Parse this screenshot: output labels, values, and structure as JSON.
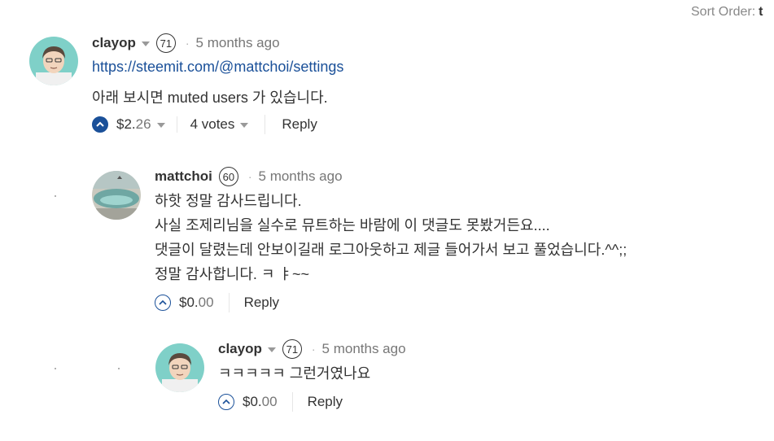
{
  "sort": {
    "label": "Sort Order:",
    "value": "t"
  },
  "comments": [
    {
      "author": "clayop",
      "reputation": "71",
      "time": "5 months ago",
      "link": "https://steemit.com/@mattchoi/settings",
      "lines": [
        "아래 보시면 muted users 가 있습니다."
      ],
      "payout_main": "$2.",
      "payout_cents": "26",
      "votes": "4 votes",
      "reply": "Reply",
      "upvoted": true
    },
    {
      "author": "mattchoi",
      "reputation": "60",
      "time": "5 months ago",
      "lines": [
        "하핫 정말 감사드립니다.",
        "사실 조제리님을 실수로 뮤트하는 바람에 이 댓글도 못봤거든요....",
        "댓글이 달렸는데 안보이길래 로그아웃하고 제글 들어가서 보고 풀었습니다.^^;;",
        "정말 감사합니다. ㅋ ㅑ~~"
      ],
      "payout_main": "$0.",
      "payout_cents": "00",
      "reply": "Reply",
      "upvoted": false
    },
    {
      "author": "clayop",
      "reputation": "71",
      "time": "5 months ago",
      "lines": [
        "ㅋㅋㅋㅋㅋ 그런거였나요"
      ],
      "payout_main": "$0.",
      "payout_cents": "00",
      "reply": "Reply",
      "upvoted": false
    }
  ],
  "colors": {
    "link": "#1a5099",
    "upvote_active": "#1a5099",
    "muted_text": "#777777"
  }
}
